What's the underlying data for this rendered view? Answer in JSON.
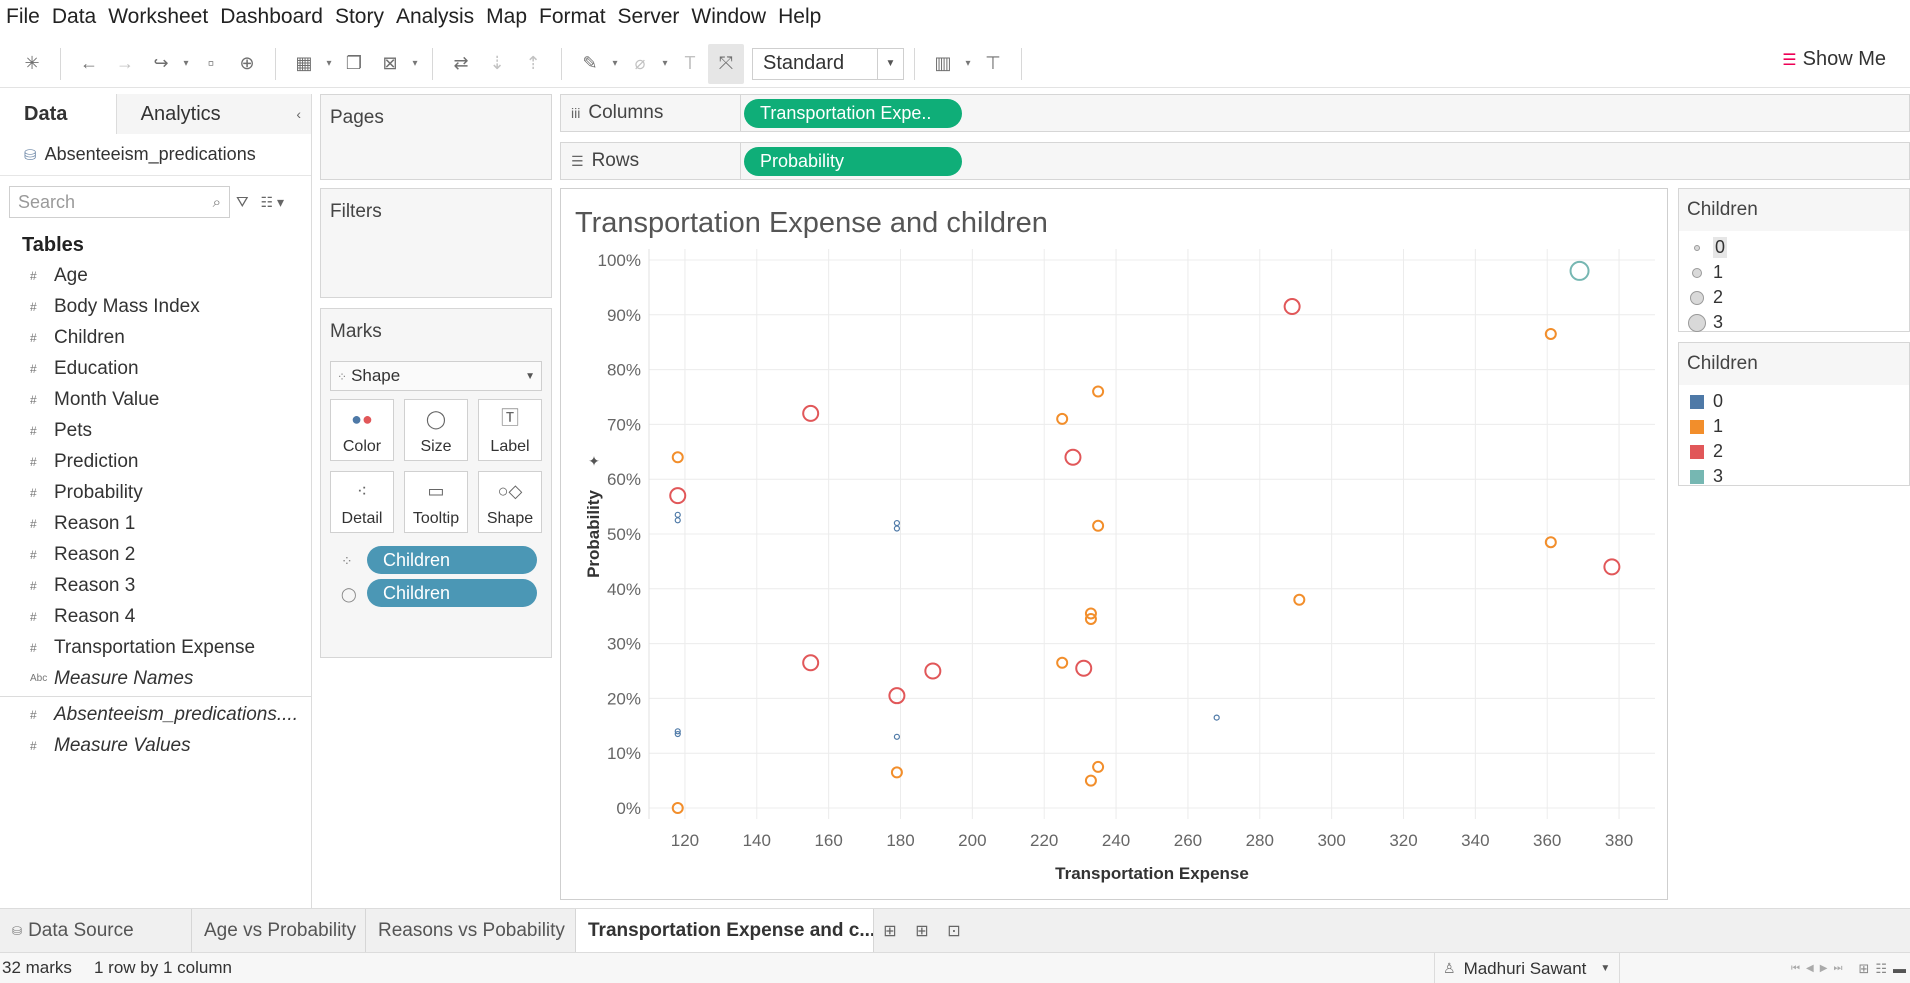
{
  "menu": [
    "File",
    "Data",
    "Worksheet",
    "Dashboard",
    "Story",
    "Analysis",
    "Map",
    "Format",
    "Server",
    "Window",
    "Help"
  ],
  "toolbar": {
    "fit_value": "Standard",
    "show_me_label": "Show Me"
  },
  "data_pane": {
    "tabs": {
      "data": "Data",
      "analytics": "Analytics"
    },
    "datasource": "Absenteeism_predications",
    "search_placeholder": "Search",
    "tables_header": "Tables",
    "fields": [
      {
        "label": "Age",
        "type": "#",
        "italic": false
      },
      {
        "label": "Body Mass Index",
        "type": "#",
        "italic": false
      },
      {
        "label": "Children",
        "type": "#",
        "italic": false
      },
      {
        "label": "Education",
        "type": "#",
        "italic": false
      },
      {
        "label": "Month Value",
        "type": "#",
        "italic": false
      },
      {
        "label": "Pets",
        "type": "#",
        "italic": false
      },
      {
        "label": "Prediction",
        "type": "#",
        "italic": false
      },
      {
        "label": "Probability",
        "type": "#",
        "italic": false
      },
      {
        "label": "Reason 1",
        "type": "#",
        "italic": false
      },
      {
        "label": "Reason 2",
        "type": "#",
        "italic": false
      },
      {
        "label": "Reason 3",
        "type": "#",
        "italic": false
      },
      {
        "label": "Reason 4",
        "type": "#",
        "italic": false
      },
      {
        "label": "Transportation Expense",
        "type": "#",
        "italic": false
      },
      {
        "label": "Measure Names",
        "type": "Abc",
        "italic": true
      }
    ],
    "extra_fields": [
      {
        "label": "Absenteeism_predications....",
        "type": "#",
        "italic": true
      },
      {
        "label": "Measure Values",
        "type": "#",
        "italic": true
      }
    ]
  },
  "cards": {
    "pages": "Pages",
    "filters": "Filters",
    "marks": "Marks",
    "marks_type": "Shape",
    "buttons": {
      "color": "Color",
      "size": "Size",
      "label": "Label",
      "detail": "Detail",
      "tooltip": "Tooltip",
      "shape": "Shape"
    },
    "pills": [
      "Children",
      "Children"
    ]
  },
  "shelves": {
    "columns_label": "Columns",
    "columns_pill": "Transportation Expe..",
    "rows_label": "Rows",
    "rows_pill": "Probability"
  },
  "legends": {
    "size_title": "Children",
    "size_items": [
      "0",
      "1",
      "2",
      "3"
    ],
    "color_title": "Children",
    "color_items": [
      {
        "label": "0",
        "color": "#4e79a7"
      },
      {
        "label": "1",
        "color": "#f28e2b"
      },
      {
        "label": "2",
        "color": "#e15759"
      },
      {
        "label": "3",
        "color": "#76b7b2"
      }
    ]
  },
  "sheet_tabs": {
    "datasource": "Data Source",
    "sheets": [
      "Age vs Probability",
      "Reasons vs Pobability",
      "Transportation Expense and c..."
    ],
    "active_index": 2
  },
  "status": {
    "marks": "32 marks",
    "layout": "1 row by 1 column",
    "user": "Madhuri Sawant"
  },
  "chart_data": {
    "type": "scatter",
    "title": "Transportation Expense and children",
    "xlabel": "Transportation Expense",
    "ylabel": "Probability",
    "xlim": [
      110,
      390
    ],
    "ylim": [
      -2,
      102
    ],
    "xticks": [
      120,
      140,
      160,
      180,
      200,
      220,
      240,
      260,
      280,
      300,
      320,
      340,
      360,
      380
    ],
    "yticks": [
      0,
      10,
      20,
      30,
      40,
      50,
      60,
      70,
      80,
      90,
      100
    ],
    "ytick_labels": [
      "0%",
      "10%",
      "20%",
      "30%",
      "40%",
      "50%",
      "60%",
      "70%",
      "80%",
      "90%",
      "100%"
    ],
    "grid": true,
    "size_by": "Children",
    "color_by": "Children",
    "points": [
      {
        "x": 118,
        "y": 53.5,
        "children": 0
      },
      {
        "x": 118,
        "y": 52.5,
        "children": 0
      },
      {
        "x": 118,
        "y": 14.0,
        "children": 0
      },
      {
        "x": 118,
        "y": 13.5,
        "children": 0
      },
      {
        "x": 179,
        "y": 52.0,
        "children": 0
      },
      {
        "x": 179,
        "y": 51.0,
        "children": 0
      },
      {
        "x": 179,
        "y": 13.0,
        "children": 0
      },
      {
        "x": 268,
        "y": 16.5,
        "children": 0
      },
      {
        "x": 118,
        "y": 64.0,
        "children": 1
      },
      {
        "x": 118,
        "y": 0.0,
        "children": 1
      },
      {
        "x": 179,
        "y": 6.5,
        "children": 1
      },
      {
        "x": 225,
        "y": 71.0,
        "children": 1
      },
      {
        "x": 235,
        "y": 76.0,
        "children": 1
      },
      {
        "x": 235,
        "y": 51.5,
        "children": 1
      },
      {
        "x": 233,
        "y": 35.5,
        "children": 1
      },
      {
        "x": 233,
        "y": 34.5,
        "children": 1
      },
      {
        "x": 225,
        "y": 26.5,
        "children": 1
      },
      {
        "x": 235,
        "y": 7.5,
        "children": 1
      },
      {
        "x": 233,
        "y": 5.0,
        "children": 1
      },
      {
        "x": 291,
        "y": 38.0,
        "children": 1
      },
      {
        "x": 361,
        "y": 86.5,
        "children": 1
      },
      {
        "x": 361,
        "y": 48.5,
        "children": 1
      },
      {
        "x": 118,
        "y": 57.0,
        "children": 2
      },
      {
        "x": 155,
        "y": 72.0,
        "children": 2
      },
      {
        "x": 155,
        "y": 26.5,
        "children": 2
      },
      {
        "x": 179,
        "y": 20.5,
        "children": 2
      },
      {
        "x": 189,
        "y": 25.0,
        "children": 2
      },
      {
        "x": 228,
        "y": 64.0,
        "children": 2
      },
      {
        "x": 231,
        "y": 25.5,
        "children": 2
      },
      {
        "x": 289,
        "y": 91.5,
        "children": 2
      },
      {
        "x": 378,
        "y": 44.0,
        "children": 2
      },
      {
        "x": 369,
        "y": 98.0,
        "children": 3
      }
    ]
  }
}
